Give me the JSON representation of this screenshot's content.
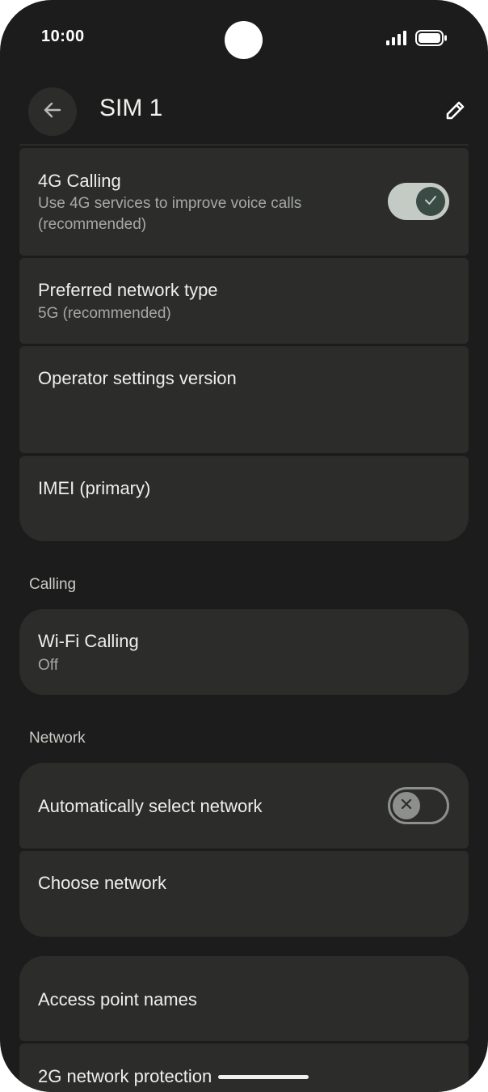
{
  "status_bar": {
    "time": "10:00",
    "icons": [
      "camera-cutout",
      "signal-icon",
      "battery-icon"
    ]
  },
  "app_bar": {
    "title": "SIM 1",
    "back_icon": "arrow-back-icon",
    "edit_icon": "pencil-edit-icon"
  },
  "sim_settings": {
    "calling_4g": {
      "title": "4G Calling",
      "subtitle_line1": "Use 4G services to improve voice calls",
      "subtitle_line2": "(recommended)",
      "enabled": true
    },
    "preferred_network": {
      "title": "Preferred network type",
      "subtitle": "5G (recommended)"
    },
    "operator_settings": {
      "title": "Operator settings version"
    },
    "imei": {
      "title": "IMEI (primary)"
    }
  },
  "calling_section": {
    "label": "Calling",
    "wifi_calling": {
      "title": "Wi-Fi Calling",
      "subtitle": "Off"
    }
  },
  "network_section": {
    "label": "Network",
    "auto_select": {
      "title": "Automatically select network",
      "enabled": false
    },
    "choose_network": {
      "title": "Choose network"
    },
    "access_point_names": {
      "title": "Access point names"
    },
    "network_protection_2g": {
      "title": "2G network protection"
    }
  },
  "colors": {
    "background": "#1b1c1b",
    "card": "#2c2d2b",
    "toggle_on_track": "#c4cbc4",
    "toggle_on_knob": "#3a4a45",
    "toggle_off": "#8d8f8b"
  }
}
